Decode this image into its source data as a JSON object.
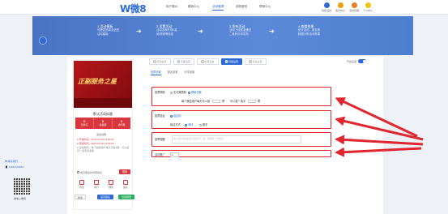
{
  "header": {
    "logo": "W微8",
    "nav": [
      "用户展示",
      "模版中心",
      "活动管理",
      "选购服务",
      "帮助中心"
    ],
    "active_nav": "活动管理",
    "right_items": [
      {
        "label": "创建活动",
        "color": "#2d6ad6",
        "icon": "create-icon"
      },
      {
        "label": "会员中心",
        "color": "#f39c12",
        "icon": "member-icon"
      },
      {
        "label": "活动管理",
        "color": "#e67e22",
        "icon": "manage-icon"
      },
      {
        "label": "个人中心",
        "color": "#f1c40f",
        "icon": "user-icon"
      }
    ]
  },
  "steps": [
    {
      "title": "1.活动模板",
      "desc1": "可随意选择合适的",
      "desc2": "活动模板"
    },
    {
      "title": "2.设置活动",
      "desc1": "活动名称/时间/奖",
      "desc2": "品/规则等信息"
    },
    {
      "title": "3.发布活动",
      "desc1": "活动上线或者通过",
      "desc2": "二维码分享发布"
    },
    {
      "title": "4.查看效果",
      "desc1": "统计活动、报名等",
      "desc2": "数据分析活动效果"
    }
  ],
  "preview": {
    "poster_title": "正副服务之星",
    "title": "默认活动标题",
    "stats": [
      {
        "value": "0",
        "label": "已参与"
      },
      {
        "value": "0",
        "label": "总投票"
      },
      {
        "value": "0",
        "label": "访问量"
      }
    ],
    "section_label": "活动说明",
    "info_lines": [
      "● 开始时间：2023-02-19 12:00:00",
      "● 结束时间：2023-02-26 12:00:00",
      "● 活动规则：每个微信用户每天可投3票，可以给同一选手投多票"
    ],
    "checkbox_label": "我已阅读并同意协议",
    "vote_button": "搜索",
    "small_icons": [
      "首页",
      "排行",
      "规则",
      "报名"
    ],
    "bottom_buttons": [
      "搜索",
      "首页报名",
      "活动规则"
    ]
  },
  "tabs": [
    {
      "num": "1",
      "label": "基础设置"
    },
    {
      "num": "2",
      "label": "页面设置"
    },
    {
      "num": "3",
      "label": "投票设置"
    },
    {
      "num": "4",
      "label": "高级设置"
    },
    {
      "num": "5",
      "label": "奖品设置"
    }
  ],
  "active_tab": "高级设置",
  "toggle_label": "开启设置",
  "subtabs": [
    "投票设置",
    "报名设置",
    "分享设置"
  ],
  "settings": {
    "s1_label": "投票限制",
    "s1_opt1": "无次数限制",
    "s1_opt2": "限制次数",
    "s1_row2_prefix": "每个微信用户每天可以投",
    "s1_row2_unit1": "票",
    "s1_row2_mid": "可以投一选手",
    "s1_row2_unit2": "票",
    "s1_val1": "3",
    "s1_val2": "1",
    "s2_label": "投票验证",
    "s2_opt": "验证码",
    "s2_row2_label": "验证方式",
    "s2_row2_opt1": "滑块",
    "s2_row2_opt2": "数字",
    "s3_label": "投票提醒",
    "s3_placeholder": "输入投票成功后提示的文字，如：感谢您一票支持",
    "s4_label": "活动推广",
    "s4_value": "0"
  },
  "contact": {
    "label": "联系我们",
    "phone": "13697126660",
    "qr_caption": "微信二维码"
  },
  "colors": {
    "accent": "#2d6ad6",
    "annotation": "#e0272f"
  }
}
